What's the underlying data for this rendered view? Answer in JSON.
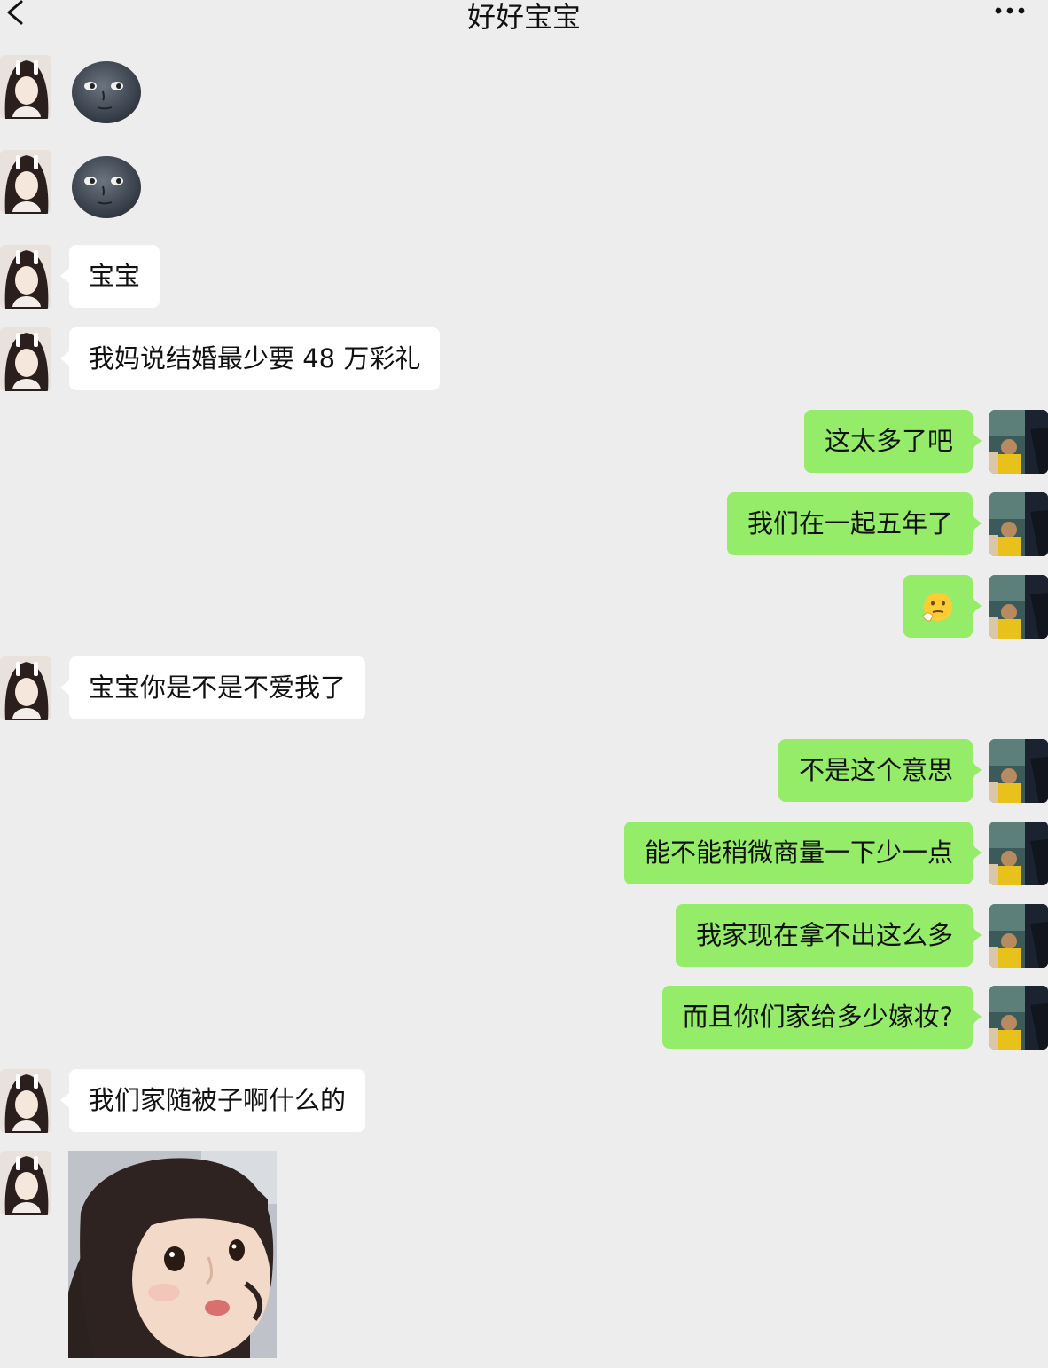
{
  "header": {
    "title": "好好宝宝"
  },
  "messages": [
    {
      "side": "in",
      "type": "sticker",
      "sticker": "moon-face-sticker"
    },
    {
      "side": "in",
      "type": "sticker",
      "sticker": "moon-face-sticker"
    },
    {
      "side": "in",
      "type": "text",
      "text": "宝宝"
    },
    {
      "side": "in",
      "type": "text",
      "text": "我妈说结婚最少要 48 万彩礼"
    },
    {
      "side": "out",
      "type": "text",
      "text": "这太多了吧"
    },
    {
      "side": "out",
      "type": "text",
      "text": "我们在一起五年了"
    },
    {
      "side": "out",
      "type": "emoji",
      "emoji": "thinking-face-emoji"
    },
    {
      "side": "in",
      "type": "text",
      "text": "宝宝你是不是不爱我了"
    },
    {
      "side": "out",
      "type": "text",
      "text": "不是这个意思"
    },
    {
      "side": "out",
      "type": "text",
      "text": "能不能稍微商量一下少一点"
    },
    {
      "side": "out",
      "type": "text",
      "text": "我家现在拿不出这么多"
    },
    {
      "side": "out",
      "type": "text",
      "text": "而且你们家给多少嫁妆?"
    },
    {
      "side": "in",
      "type": "text",
      "text": "我们家随被子啊什么的"
    },
    {
      "side": "in",
      "type": "image",
      "image": "little-girl-looking-up-photo"
    }
  ],
  "icons": {
    "back": "chevron-left-icon",
    "more": "more-dots-icon"
  },
  "colors": {
    "background": "#ededed",
    "incoming_bubble": "#ffffff",
    "outgoing_bubble": "#95ec69"
  }
}
